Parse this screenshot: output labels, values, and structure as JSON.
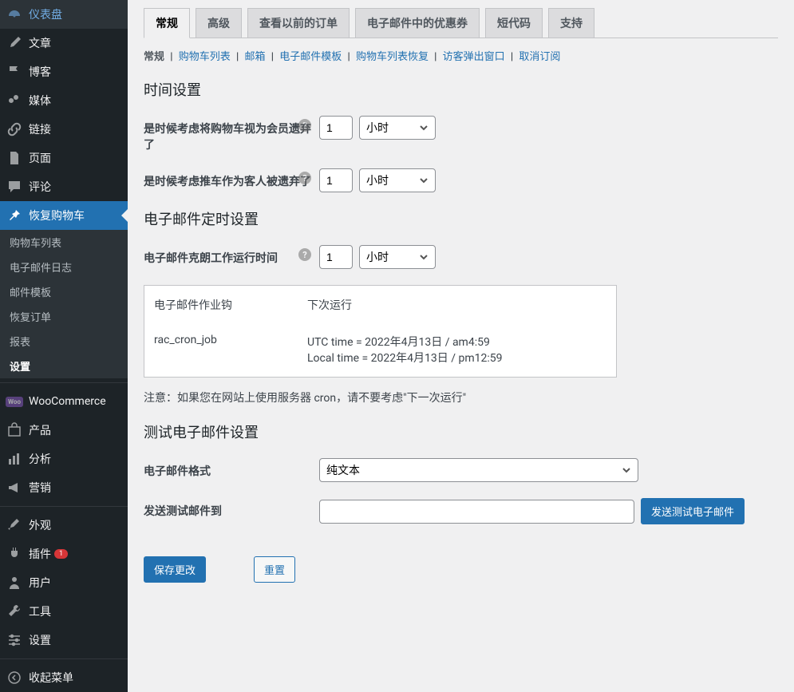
{
  "sidebar": {
    "items": [
      {
        "icon": "dashboard",
        "label": "仪表盘"
      },
      {
        "icon": "post",
        "label": "文章"
      },
      {
        "icon": "flag",
        "label": "博客"
      },
      {
        "icon": "media",
        "label": "媒体"
      },
      {
        "icon": "link",
        "label": "链接"
      },
      {
        "icon": "page",
        "label": "页面"
      },
      {
        "icon": "comment",
        "label": "评论"
      },
      {
        "icon": "pin",
        "label": "恢复购物车",
        "active": true,
        "submenu": [
          {
            "label": "购物车列表"
          },
          {
            "label": "电子邮件日志"
          },
          {
            "label": "邮件模板"
          },
          {
            "label": "恢复订单"
          },
          {
            "label": "报表"
          },
          {
            "label": "设置",
            "active": true
          }
        ]
      },
      {
        "icon": "woo",
        "label": "WooCommerce"
      },
      {
        "icon": "product",
        "label": "产品"
      },
      {
        "icon": "analytics",
        "label": "分析"
      },
      {
        "icon": "marketing",
        "label": "营销"
      },
      {
        "icon": "appearance",
        "label": "外观"
      },
      {
        "icon": "plugins",
        "label": "插件",
        "badge": "1"
      },
      {
        "icon": "users",
        "label": "用户"
      },
      {
        "icon": "tools",
        "label": "工具"
      },
      {
        "icon": "settings",
        "label": "设置"
      },
      {
        "icon": "collapse",
        "label": "收起菜单"
      }
    ]
  },
  "tabs": [
    {
      "label": "常规",
      "active": true
    },
    {
      "label": "高级"
    },
    {
      "label": "查看以前的订单"
    },
    {
      "label": "电子邮件中的优惠券"
    },
    {
      "label": "短代码"
    },
    {
      "label": "支持"
    }
  ],
  "subsub": {
    "current": "常规",
    "links": [
      "购物车列表",
      "邮箱",
      "电子邮件模板",
      "购物车列表恢复",
      "访客弹出窗口",
      "取消订阅"
    ]
  },
  "sections": {
    "time_heading": "时间设置",
    "member_abandon_label": "是时候考虑将购物车视为会员遗弃了",
    "member_abandon_value": "1",
    "member_abandon_unit": "小时",
    "guest_abandon_label": "是时候考虑推车作为客人被遗弃了",
    "guest_abandon_value": "1",
    "guest_abandon_unit": "小时",
    "email_timer_heading": "电子邮件定时设置",
    "cron_label": "电子邮件克朗工作运行时间",
    "cron_value": "1",
    "cron_unit": "小时",
    "table_hook_header": "电子邮件作业钩",
    "table_next_header": "下次运行",
    "table_hook_value": "rac_cron_job",
    "table_next_utc": "UTC time = 2022年4月13日 / am4:59",
    "table_next_local": "Local time = 2022年4月13日 / pm12:59",
    "cron_note": "注意：如果您在网站上使用服务器 cron，请不要考虑\"下一次运行\"",
    "test_heading": "测试电子邮件设置",
    "format_label": "电子邮件格式",
    "format_value": "纯文本",
    "send_to_label": "发送测试邮件到",
    "send_button": "发送测试电子邮件",
    "save_button": "保存更改",
    "reset_button": "重置"
  }
}
